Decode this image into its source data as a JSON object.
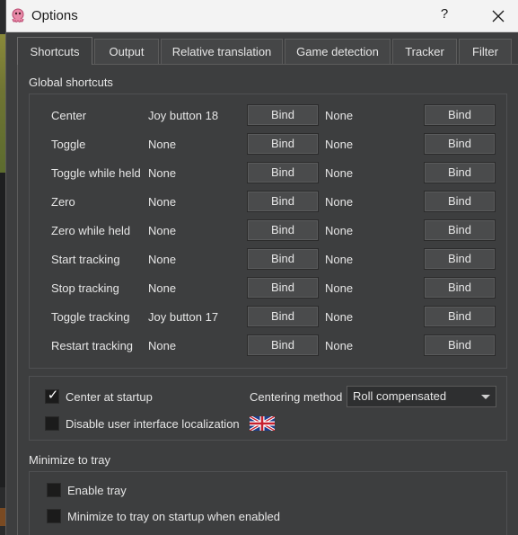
{
  "window": {
    "title": "Options",
    "help_label": "?"
  },
  "tabs": [
    {
      "label": "Shortcuts",
      "active": true
    },
    {
      "label": "Output"
    },
    {
      "label": "Relative translation"
    },
    {
      "label": "Game detection"
    },
    {
      "label": "Tracker"
    },
    {
      "label": "Filter"
    }
  ],
  "global_shortcuts": {
    "title": "Global shortcuts",
    "bind_label": "Bind",
    "rows": [
      {
        "action": "Center",
        "key1": "Joy button 18",
        "key2": "None"
      },
      {
        "action": "Toggle",
        "key1": "None",
        "key2": "None"
      },
      {
        "action": "Toggle while held",
        "key1": "None",
        "key2": "None"
      },
      {
        "action": "Zero",
        "key1": "None",
        "key2": "None"
      },
      {
        "action": "Zero while held",
        "key1": "None",
        "key2": "None"
      },
      {
        "action": "Start tracking",
        "key1": "None",
        "key2": "None"
      },
      {
        "action": "Stop tracking",
        "key1": "None",
        "key2": "None"
      },
      {
        "action": "Toggle tracking",
        "key1": "Joy button 17",
        "key2": "None"
      },
      {
        "action": "Restart tracking",
        "key1": "None",
        "key2": "None"
      }
    ]
  },
  "startup": {
    "center_at_startup": {
      "label": "Center at startup",
      "checked": true,
      "mark": "✓"
    },
    "disable_localization": {
      "label": "Disable user interface localization",
      "checked": false
    },
    "centering_method": {
      "label": "Centering method",
      "value": "Roll compensated"
    }
  },
  "tray": {
    "title": "Minimize to tray",
    "enable_tray": {
      "label": "Enable tray",
      "checked": false
    },
    "minimize_on_startup": {
      "label": "Minimize to tray on startup when enabled",
      "checked": false
    }
  },
  "colors": {
    "accent_bg": "#3d3e3f",
    "button_bg": "#4a4b4c",
    "titlebar_bg": "#f3f3f3"
  }
}
